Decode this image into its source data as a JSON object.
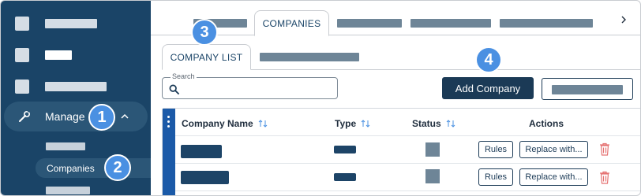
{
  "sidebar": {
    "manage_label": "Manage",
    "active_sub_item": "Companies"
  },
  "badges": [
    "1",
    "2",
    "3",
    "4"
  ],
  "top_tabs": {
    "active_label": "COMPANIES"
  },
  "sub_tabs": {
    "active_label": "COMPANY LIST"
  },
  "search": {
    "label": "Search",
    "value": ""
  },
  "toolbar": {
    "add_label": "Add Company"
  },
  "table": {
    "columns": {
      "name": "Company Name",
      "type": "Type",
      "status": "Status",
      "actions": "Actions"
    },
    "rows": [
      {
        "rules_label": "Rules",
        "replace_label": "Replace with..."
      },
      {
        "rules_label": "Rules",
        "replace_label": "Replace with..."
      }
    ]
  },
  "colors": {
    "sidebar": "#1a4467",
    "accent": "#4a90e2",
    "primary_button": "#1b3a56",
    "delete": "#e57373"
  }
}
